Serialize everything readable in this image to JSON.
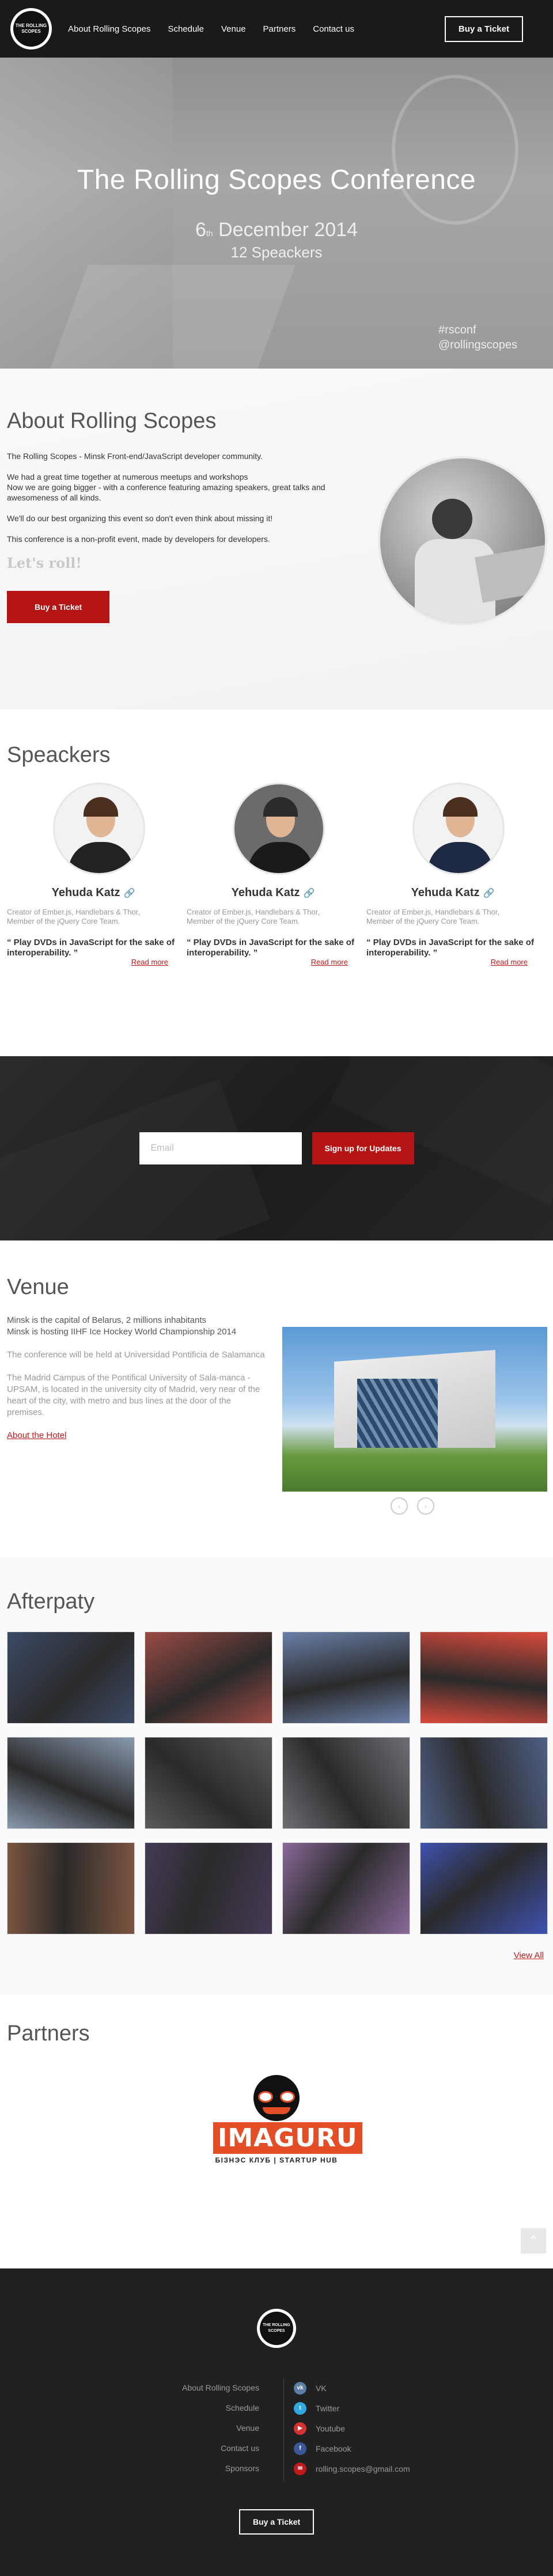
{
  "nav": {
    "logo_text": "THE ROLLING SCOPES",
    "links": [
      "About Rolling Scopes",
      "Schedule",
      "Venue",
      "Partners",
      "Contact us"
    ],
    "cta": "Buy a Ticket"
  },
  "hero": {
    "title": "The Rolling Scopes Conference",
    "date_day": "6",
    "date_suffix": "th",
    "date_rest": "December 2014",
    "speakers": "12 Speackers",
    "tag1": "#rsconf",
    "tag2": "@rollingscopes"
  },
  "about": {
    "title": "About Rolling Scopes",
    "p1": "The Rolling Scopes - Minsk Front-end/JavaScript developer community.",
    "p2": "We had a great time together at numerous meetups and workshops",
    "p3": "Now we are going bigger - with a conference featuring amazing speakers, great talks and awesomeness of all kinds.",
    "p4": "We'll do our best organizing this event so don't even think about missing it!",
    "p5": "This conference is a non-profit event, made by developers for developers.",
    "lets_roll": "Let's roll!",
    "cta": "Buy a Ticket"
  },
  "speakers": {
    "title": "Speackers",
    "items": [
      {
        "name": "Yehuda Katz",
        "desc1": "Creator of Ember.js, Handlebars & Thor,",
        "desc2": "Member of the jQuery Core Team.",
        "quote": "“ Play DVDs in JavaScript for the sake of interoperability. ”",
        "more": "Read more"
      },
      {
        "name": "Yehuda Katz",
        "desc1": "Creator of Ember.js, Handlebars & Thor,",
        "desc2": "Member of the jQuery Core Team.",
        "quote": "“ Play DVDs in JavaScript for the sake of interoperability. ”",
        "more": "Read more"
      },
      {
        "name": "Yehuda Katz",
        "desc1": "Creator of Ember.js, Handlebars & Thor,",
        "desc2": "Member of the jQuery Core Team.",
        "quote": "“ Play DVDs in JavaScript for the sake of interoperability. ”",
        "more": "Read more"
      }
    ]
  },
  "subscribe": {
    "placeholder": "Email",
    "button": "Sign up for Updates"
  },
  "venue": {
    "title": "Venue",
    "l1": "Minsk is the capital of Belarus, 2 millions inhabitants",
    "l2": "Minsk is hosting IIHF Ice Hockey World Championship 2014",
    "p2": "The conference will be held at Universidad Pontificia de Salamanca",
    "p3": "The Madrid Campus of the Pontifical University of Sala-manca - UPSAM, is located in the university city of Madrid, very near of the heart of the city, with metro and bus lines at the door of the premises.",
    "link": "About the Hotel",
    "prev": "‹",
    "next": "›"
  },
  "afterpaty": {
    "title": "Afterpaty",
    "view_all": "View All",
    "photo_colors": [
      "#3c4a66",
      "#9b4a44",
      "#6a7fa8",
      "#d94a3c",
      "#8a9ab0",
      "#5a5a5a",
      "#6f6e75",
      "#4f5f85",
      "#7c5540",
      "#463a56",
      "#8a6a9a",
      "#3f52b0"
    ]
  },
  "partners": {
    "title": "Partners",
    "logo_word": "IMAGURU",
    "logo_sub": "БІЗНЭС КЛУБ | STARTUP HUB",
    "scroll_top": "⌃"
  },
  "footer": {
    "logo_text": "THE ROLLING SCOPES",
    "links": [
      "About Rolling Scopes",
      "Schedule",
      "Venue",
      "Contact us",
      "Sponsors"
    ],
    "social": [
      {
        "icon": "vk-icon",
        "glyph": "vk",
        "label": "VK",
        "color": "#5b7fa6"
      },
      {
        "icon": "twitter-icon",
        "glyph": "t",
        "label": "Twitter",
        "color": "#2fa9e0"
      },
      {
        "icon": "youtube-icon",
        "glyph": "▶",
        "label": "Youtube",
        "color": "#d63232"
      },
      {
        "icon": "facebook-icon",
        "glyph": "f",
        "label": "Facebook",
        "color": "#3b5998"
      },
      {
        "icon": "email-icon",
        "glyph": "✉",
        "label": "rolling.scopes@gmail.com",
        "color": "#c21a1a"
      }
    ],
    "cta": "Buy a Ticket"
  }
}
